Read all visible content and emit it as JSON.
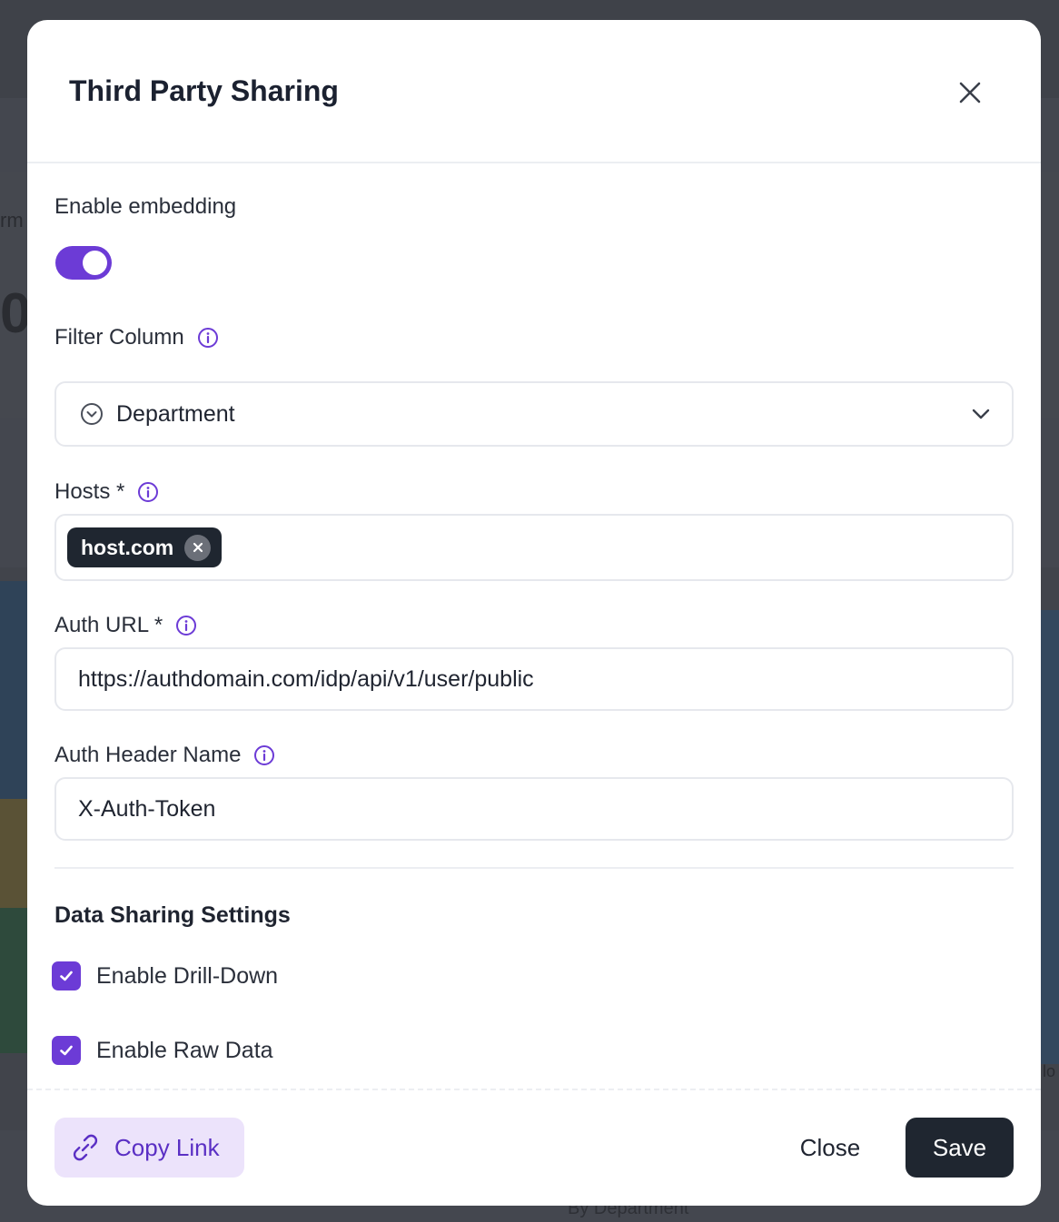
{
  "background": {
    "fragment_a": "rm",
    "fragment_b": "0",
    "fragment_c": "lo",
    "fragment_d": "By Department"
  },
  "modal": {
    "title": "Third Party Sharing",
    "close_icon": "close-icon"
  },
  "embedding": {
    "label": "Enable embedding",
    "enabled": true
  },
  "filter_column": {
    "label": "Filter Column",
    "value": "Department",
    "icon": "chevron-circle-icon"
  },
  "hosts": {
    "label": "Hosts *",
    "chips": [
      "host.com"
    ]
  },
  "auth_url": {
    "label": "Auth URL *",
    "value": "https://authdomain.com/idp/api/v1/user/public"
  },
  "auth_header": {
    "label": "Auth Header Name",
    "value": "X-Auth-Token"
  },
  "data_sharing": {
    "title": "Data Sharing Settings",
    "options": [
      {
        "label": "Enable Drill-Down",
        "checked": true
      },
      {
        "label": "Enable Raw Data",
        "checked": true
      }
    ]
  },
  "footer": {
    "copy_link_label": "Copy Link",
    "close_label": "Close",
    "save_label": "Save"
  },
  "colors": {
    "accent": "#6c3bd6",
    "primary_dark": "#1f2630",
    "copy_bg": "#ece3fb"
  }
}
